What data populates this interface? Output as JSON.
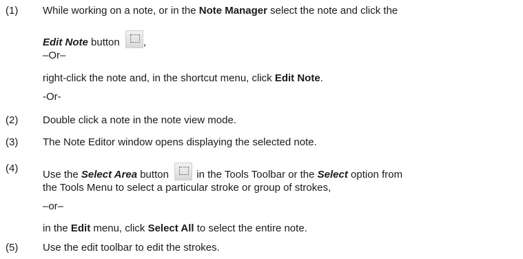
{
  "steps": [
    {
      "number": "(1)",
      "line1_prefix": "While working on a note, or in the ",
      "line1_bold": "Note Manager",
      "line1_suffix": " select the note and click the",
      "line2_bolditalic": "Edit Note",
      "line2_suffix": " button",
      "line2_end": ",",
      "or_1": "–Or–",
      "line3_prefix": "right-click the note and, in the shortcut menu, click ",
      "line3_bold": "Edit Note",
      "line3_suffix": ".",
      "or_2": "-Or-",
      "icon": "select-area-icon"
    },
    {
      "number": "(2)",
      "text": "Double click a note in the note view mode."
    },
    {
      "number": "(3)",
      "text": "The Note Editor window opens displaying the selected note."
    },
    {
      "number": "(4)",
      "line1_prefix": "Use the ",
      "line1_bolditalic": "Select Area",
      "line1_mid": " button",
      "line1_mid2": " in the Tools Toolbar or the ",
      "line1_bolditalic2": "Select",
      "line1_suffix": " option from",
      "line2": "the Tools Menu to select a particular stroke or group of strokes,",
      "or": "–or–",
      "line3_prefix": "in the ",
      "line3_bold1": "Edit",
      "line3_mid": " menu, click ",
      "line3_bold2": "Select All",
      "line3_suffix": " to select the entire note.",
      "icon": "select-area-icon"
    },
    {
      "number": "(5)",
      "text": "Use the edit toolbar to edit the strokes."
    }
  ]
}
